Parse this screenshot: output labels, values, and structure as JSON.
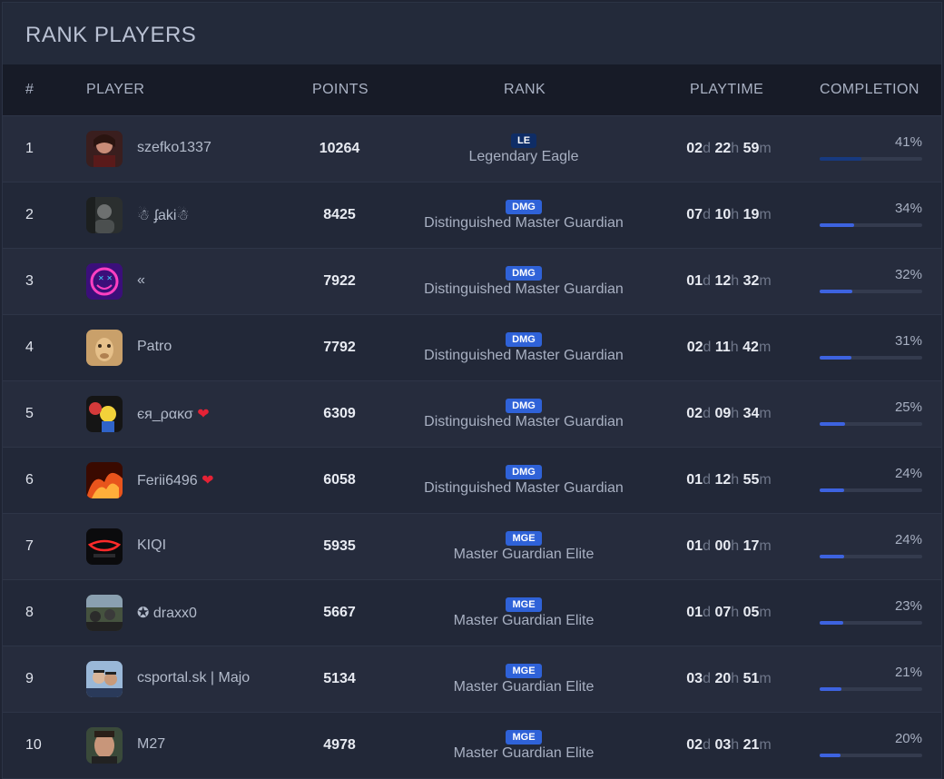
{
  "title": "RANK PLAYERS",
  "columns": {
    "num": "#",
    "player": "PLAYER",
    "points": "POINTS",
    "rank": "RANK",
    "playtime": "PLAYTIME",
    "completion": "COMPLETION"
  },
  "units": {
    "d": "d",
    "h": "h",
    "m": "m"
  },
  "colors": {
    "badge": "#2f62d8",
    "badge_top": "#0f2d66",
    "progress": "#3d63e0",
    "progress_top": "#173a80",
    "heart": "#e52235"
  },
  "rows": [
    {
      "num": "1",
      "name": "szefko1337",
      "points": "10264",
      "badge": "LE",
      "rank": "Legendary Eagle",
      "d": "02",
      "h": "22",
      "m": "59",
      "completion": "41%",
      "completion_value": 0.41,
      "avatar": "avatar-dark-portrait"
    },
    {
      "num": "2",
      "name": "☃ ʄaki☃",
      "points": "8425",
      "badge": "DMG",
      "rank": "Distinguished Master Guardian",
      "d": "07",
      "h": "10",
      "m": "19",
      "completion": "34%",
      "completion_value": 0.34,
      "avatar": "avatar-grey-figure"
    },
    {
      "num": "3",
      "name": "«",
      "points": "7922",
      "badge": "DMG",
      "rank": "Distinguished Master Guardian",
      "d": "01",
      "h": "12",
      "m": "32",
      "completion": "32%",
      "completion_value": 0.32,
      "avatar": "avatar-neon-smiley"
    },
    {
      "num": "4",
      "name": "Patro",
      "points": "7792",
      "badge": "DMG",
      "rank": "Distinguished Master Guardian",
      "d": "02",
      "h": "11",
      "m": "42",
      "completion": "31%",
      "completion_value": 0.31,
      "avatar": "avatar-camel"
    },
    {
      "num": "5",
      "name": "єя_ρακσ",
      "heart": "❤",
      "points": "6309",
      "badge": "DMG",
      "rank": "Distinguished Master Guardian",
      "d": "02",
      "h": "09",
      "m": "34",
      "completion": "25%",
      "completion_value": 0.25,
      "avatar": "avatar-cartoon"
    },
    {
      "num": "6",
      "name": "Ferii6496",
      "heart": "❤",
      "points": "6058",
      "badge": "DMG",
      "rank": "Distinguished Master Guardian",
      "d": "01",
      "h": "12",
      "m": "55",
      "completion": "24%",
      "completion_value": 0.24,
      "avatar": "avatar-fire"
    },
    {
      "num": "7",
      "name": "KIQI",
      "points": "5935",
      "badge": "MGE",
      "rank": "Master Guardian Elite",
      "d": "01",
      "h": "00",
      "m": "17",
      "completion": "24%",
      "completion_value": 0.24,
      "avatar": "avatar-car-light"
    },
    {
      "num": "8",
      "name": "✪ draxx0",
      "points": "5667",
      "badge": "MGE",
      "rank": "Master Guardian Elite",
      "d": "01",
      "h": "07",
      "m": "05",
      "completion": "23%",
      "completion_value": 0.23,
      "avatar": "avatar-crowd"
    },
    {
      "num": "9",
      "name": "csportal.sk | Majo",
      "points": "5134",
      "badge": "MGE",
      "rank": "Master Guardian Elite",
      "d": "03",
      "h": "20",
      "m": "51",
      "completion": "21%",
      "completion_value": 0.21,
      "avatar": "avatar-couple"
    },
    {
      "num": "10",
      "name": "M27",
      "points": "4978",
      "badge": "MGE",
      "rank": "Master Guardian Elite",
      "d": "02",
      "h": "03",
      "m": "21",
      "completion": "20%",
      "completion_value": 0.2,
      "avatar": "avatar-face"
    }
  ]
}
